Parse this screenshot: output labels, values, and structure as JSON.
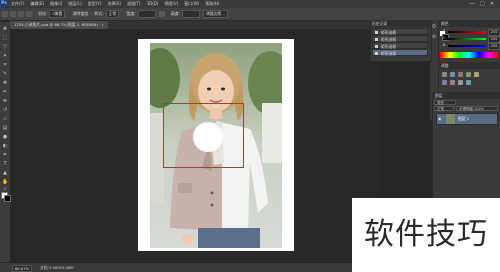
{
  "app": {
    "logo": "Ps",
    "menu": [
      "文件(F)",
      "编辑(E)",
      "图像(I)",
      "图层(L)",
      "类型(Y)",
      "选择(S)",
      "滤镜(T)",
      "3D(D)",
      "视图(V)",
      "窗口(W)",
      "帮助(H)"
    ],
    "window_controls": [
      "—",
      "□",
      "✕"
    ]
  },
  "options_bar": {
    "feather_label": "羽化:",
    "feather_value": "0像素",
    "antialias_label": "消除锯齿",
    "style_label": "样式:",
    "style_value": "正常",
    "width_label": "宽度:",
    "height_label": "高度:",
    "refine_button": "调整边缘..."
  },
  "document": {
    "tab_title": "1234-小孩照片.psd @ 66.7%(图层 1, RGB/8#)",
    "zoom": "66.67%",
    "doc_info": "文档:3.08M/3.08M"
  },
  "history_panel": {
    "title": "历史记录",
    "items": [
      "矩形选框",
      "矩形选框",
      "矩形选框",
      "矩形选框"
    ]
  },
  "color_panel": {
    "title": "颜色",
    "r_label": "R",
    "g_label": "G",
    "b_label": "B",
    "r_value": "255",
    "g_value": "255",
    "b_value": "255"
  },
  "adjustments_panel": {
    "title": "调整"
  },
  "layers_panel": {
    "title": "图层",
    "kind_filter": "类型",
    "blend_mode": "正常",
    "opacity_label": "不透明度:",
    "opacity_value": "100%",
    "lock_label": "锁定:",
    "fill_label": "填充:",
    "fill_value": "100%",
    "layer_name": "图层 1"
  },
  "watermark": {
    "text": "软件技巧"
  },
  "colors": {
    "selection_rect": "#d9262c",
    "accent_layer": "#5a6c84"
  }
}
